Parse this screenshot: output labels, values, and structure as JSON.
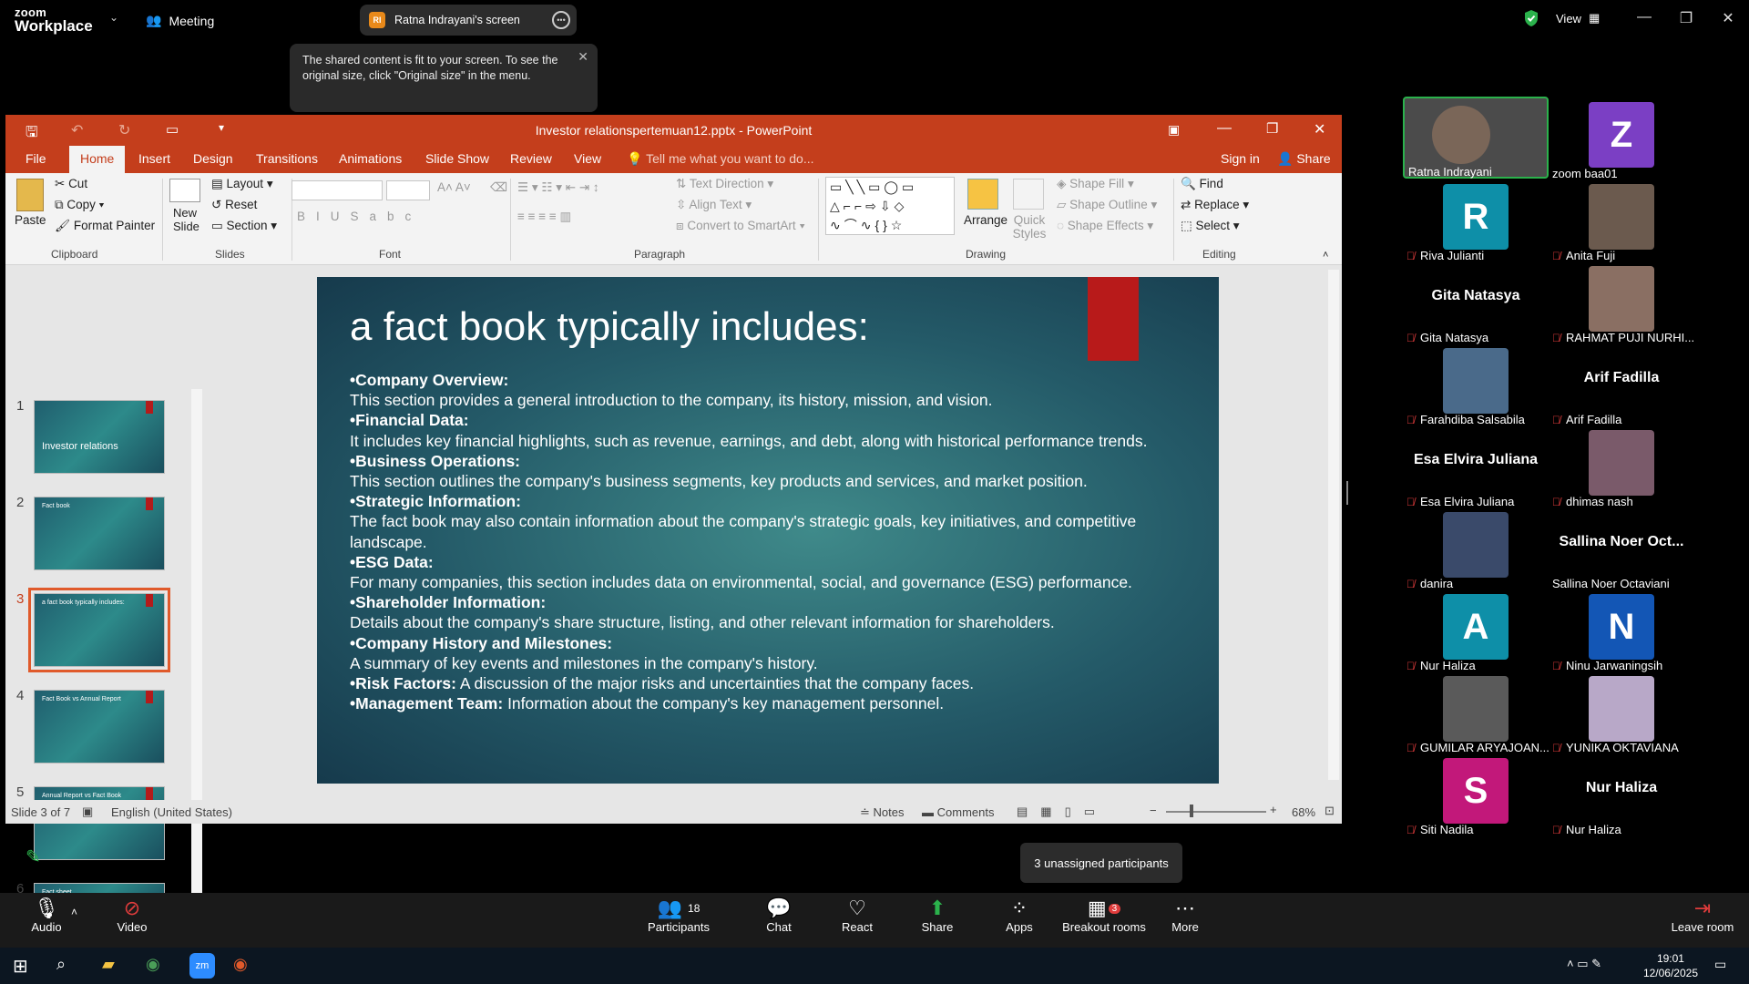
{
  "zoom": {
    "logo_line1": "zoom",
    "logo_line2": "Workplace",
    "meeting_label": "Meeting",
    "share_badge": "RI",
    "share_label": "Ratna Indrayani's screen",
    "view_label": "View",
    "tooltip": "The shared content is fit to your screen. To see the original size, click \"Original size\" in the menu.",
    "unassigned": "3 unassigned participants"
  },
  "ppt": {
    "title": "Investor relationspertemuan12.pptx - PowerPoint",
    "tabs": [
      "File",
      "Home",
      "Insert",
      "Design",
      "Transitions",
      "Animations",
      "Slide Show",
      "Review",
      "View"
    ],
    "tell_me": "Tell me what you want to do...",
    "sign_in": "Sign in",
    "share": "Share",
    "clipboard": {
      "paste": "Paste",
      "cut": "Cut",
      "copy": "Copy",
      "format_painter": "Format Painter",
      "group": "Clipboard"
    },
    "slides": {
      "new_slide": "New Slide",
      "layout": "Layout",
      "reset": "Reset",
      "section": "Section",
      "group": "Slides"
    },
    "font_group": "Font",
    "paragraph": {
      "text_direction": "Text Direction",
      "align_text": "Align Text",
      "convert": "Convert to SmartArt",
      "group": "Paragraph"
    },
    "drawing": {
      "arrange": "Arrange",
      "quick_styles": "Quick Styles",
      "shape_fill": "Shape Fill",
      "shape_outline": "Shape Outline",
      "shape_effects": "Shape Effects",
      "group": "Drawing"
    },
    "editing": {
      "find": "Find",
      "replace": "Replace",
      "select": "Select",
      "group": "Editing"
    },
    "thumbs": [
      {
        "num": "1",
        "title": "Investor relations"
      },
      {
        "num": "2",
        "title": "Fact book"
      },
      {
        "num": "3",
        "title": "a fact book typically includes:"
      },
      {
        "num": "4",
        "title": "Fact Book vs Annual Report"
      },
      {
        "num": "5",
        "title": "Annual Report vs Fact Book"
      },
      {
        "num": "6",
        "title": "Fact sheet"
      }
    ],
    "slide": {
      "title": "a fact book typically includes:",
      "items": [
        {
          "head": "•Company Overview:",
          "text": "This section provides a general introduction to the company, its history, mission, and vision."
        },
        {
          "head": "•Financial Data:",
          "text": "It includes key financial highlights, such as revenue, earnings, and debt, along with historical performance trends."
        },
        {
          "head": "•Business Operations:",
          "text": "This section outlines the company's business segments, key products and services, and market position."
        },
        {
          "head": "•Strategic Information:",
          "text": "The fact book may also contain information about the company's strategic goals, key initiatives, and competitive landscape."
        },
        {
          "head": "•ESG Data:",
          "text": "For many companies, this section includes data on environmental, social, and governance (ESG) performance."
        },
        {
          "head": "•Shareholder Information:",
          "text": "Details about the company's share structure, listing, and other relevant information for shareholders."
        },
        {
          "head": "•Company History and Milestones:",
          "text": "A summary of key events and milestones in the company's history."
        }
      ],
      "inline_items": [
        {
          "head": "•Risk Factors:",
          "text": " A discussion of the major risks and uncertainties that the company faces."
        },
        {
          "head": "•Management Team:",
          "text": " Information about the company's key management personnel."
        }
      ]
    },
    "status": {
      "slide_of": "Slide 3 of 7",
      "language": "English (United States)",
      "notes": "Notes",
      "comments": "Comments",
      "zoom": "68%"
    }
  },
  "participants": [
    {
      "name": "Ratna Indrayani",
      "type": "video",
      "muted": false
    },
    {
      "name": "zoom baa01",
      "type": "letter",
      "letter": "Z",
      "color": "#7b3fc4",
      "muted": false
    },
    {
      "name": "Riva Julianti",
      "type": "letter",
      "letter": "R",
      "color": "#0e8fa8",
      "muted": true
    },
    {
      "name": "Anita Fuji",
      "type": "photo",
      "muted": true
    },
    {
      "name": "Gita Natasya",
      "type": "text",
      "big": "Gita Natasya",
      "muted": true
    },
    {
      "name": "RAHMAT PUJI NURHI...",
      "type": "photo",
      "muted": true
    },
    {
      "name": "Farahdiba Salsabila",
      "type": "photo",
      "muted": true
    },
    {
      "name": "Arif Fadilla",
      "type": "text",
      "big": "Arif Fadilla",
      "muted": true
    },
    {
      "name": "Esa Elvira Juliana",
      "type": "text",
      "big": "Esa Elvira Juliana",
      "muted": true
    },
    {
      "name": "dhimas nash",
      "type": "photo",
      "muted": true
    },
    {
      "name": "danira",
      "type": "photo",
      "muted": true
    },
    {
      "name": "Sallina Noer Octaviani",
      "type": "text",
      "big": "Sallina Noer Oct...",
      "muted": false
    },
    {
      "name": "Nur Haliza",
      "type": "letter",
      "letter": "A",
      "color": "#0e8fa8",
      "muted": true
    },
    {
      "name": "Ninu Jarwaningsih",
      "type": "letter",
      "letter": "N",
      "color": "#1356b5",
      "muted": true
    },
    {
      "name": "GUMILAR ARYAJOAN...",
      "type": "photo",
      "muted": true
    },
    {
      "name": "YUNIKA OKTAVIANA",
      "type": "photo",
      "muted": true
    },
    {
      "name": "Siti Nadila",
      "type": "letter",
      "letter": "S",
      "color": "#c2187a",
      "muted": true
    },
    {
      "name": "Nur Haliza",
      "type": "text",
      "big": "Nur Haliza",
      "muted": true
    }
  ],
  "toolbar": {
    "audio": "Audio",
    "video": "Video",
    "participants": "Participants",
    "participants_count": "18",
    "chat": "Chat",
    "react": "React",
    "share": "Share",
    "apps": "Apps",
    "breakout": "Breakout rooms",
    "breakout_badge": "3",
    "more": "More",
    "leave": "Leave room"
  },
  "taskbar": {
    "time": "19:01",
    "date": "12/06/2025"
  }
}
